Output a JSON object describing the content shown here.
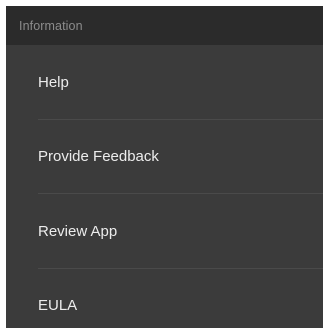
{
  "section": {
    "title": "Information"
  },
  "menu": {
    "items": [
      {
        "label": "Help"
      },
      {
        "label": "Provide Feedback"
      },
      {
        "label": "Review App"
      },
      {
        "label": "EULA"
      }
    ]
  },
  "colors": {
    "header_background": "#2b2b2b",
    "list_background": "#3b3b3b",
    "header_text": "#8c8c8c",
    "item_text": "#ececec",
    "divider": "#4a4a4a"
  }
}
